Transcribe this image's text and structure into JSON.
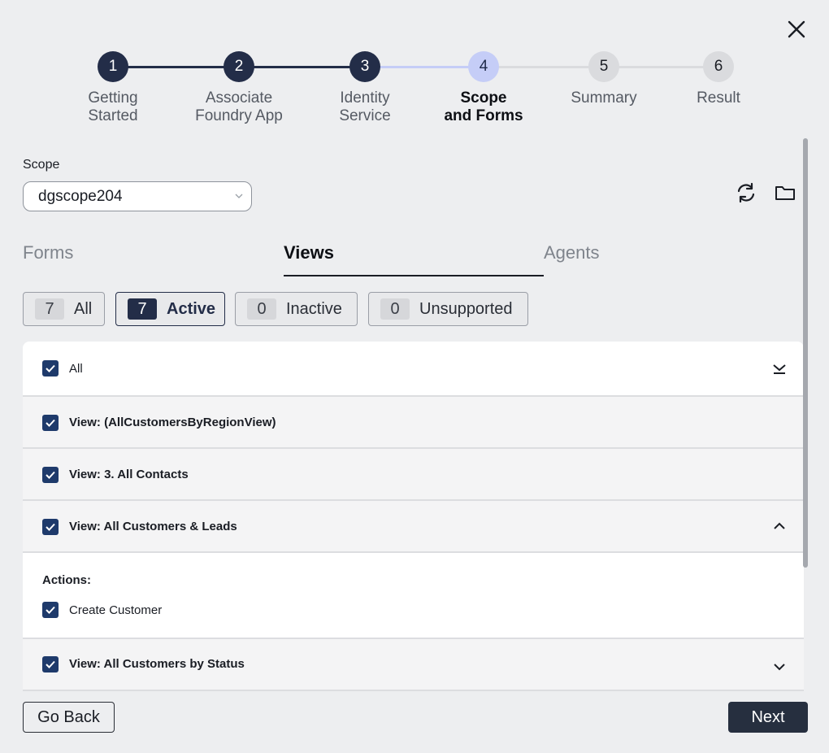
{
  "stepper": {
    "steps": [
      {
        "number": "1",
        "label": "Getting\nStarted",
        "state": "done"
      },
      {
        "number": "2",
        "label": "Associate\nFoundry App",
        "state": "done"
      },
      {
        "number": "3",
        "label": "Identity\nService",
        "state": "done"
      },
      {
        "number": "4",
        "label": "Scope\nand Forms",
        "state": "current"
      },
      {
        "number": "5",
        "label": "Summary",
        "state": "todo"
      },
      {
        "number": "6",
        "label": "Result",
        "state": "todo"
      }
    ]
  },
  "scope": {
    "label": "Scope",
    "selected": "dgscope204"
  },
  "tabs": [
    {
      "label": "Forms",
      "active": false
    },
    {
      "label": "Views",
      "active": true
    },
    {
      "label": "Agents",
      "active": false
    }
  ],
  "filters": [
    {
      "count": "7",
      "label": "All",
      "active": false
    },
    {
      "count": "7",
      "label": "Active",
      "active": true
    },
    {
      "count": "0",
      "label": "Inactive",
      "active": false
    },
    {
      "count": "0",
      "label": "Unsupported",
      "active": false
    }
  ],
  "list": {
    "all_label": "All",
    "views": [
      {
        "label": "View: (AllCustomersByRegionView)",
        "checked": true
      },
      {
        "label": "View: 3. All Contacts",
        "checked": true
      },
      {
        "label": "View: All Customers & Leads",
        "checked": true,
        "expanded": true
      },
      {
        "label": "View: All Customers by Status",
        "checked": true,
        "expanded": false
      }
    ],
    "actions_heading": "Actions:",
    "actions": [
      {
        "label": "Create Customer",
        "checked": true
      }
    ]
  },
  "footer": {
    "back_label": "Go Back",
    "next_label": "Next"
  },
  "colors": {
    "step_done": "#232d48",
    "step_current": "#c5cdf7",
    "step_todo": "#dadbde",
    "checkbox": "#1e3a6b",
    "primary_button": "#262f3f"
  }
}
